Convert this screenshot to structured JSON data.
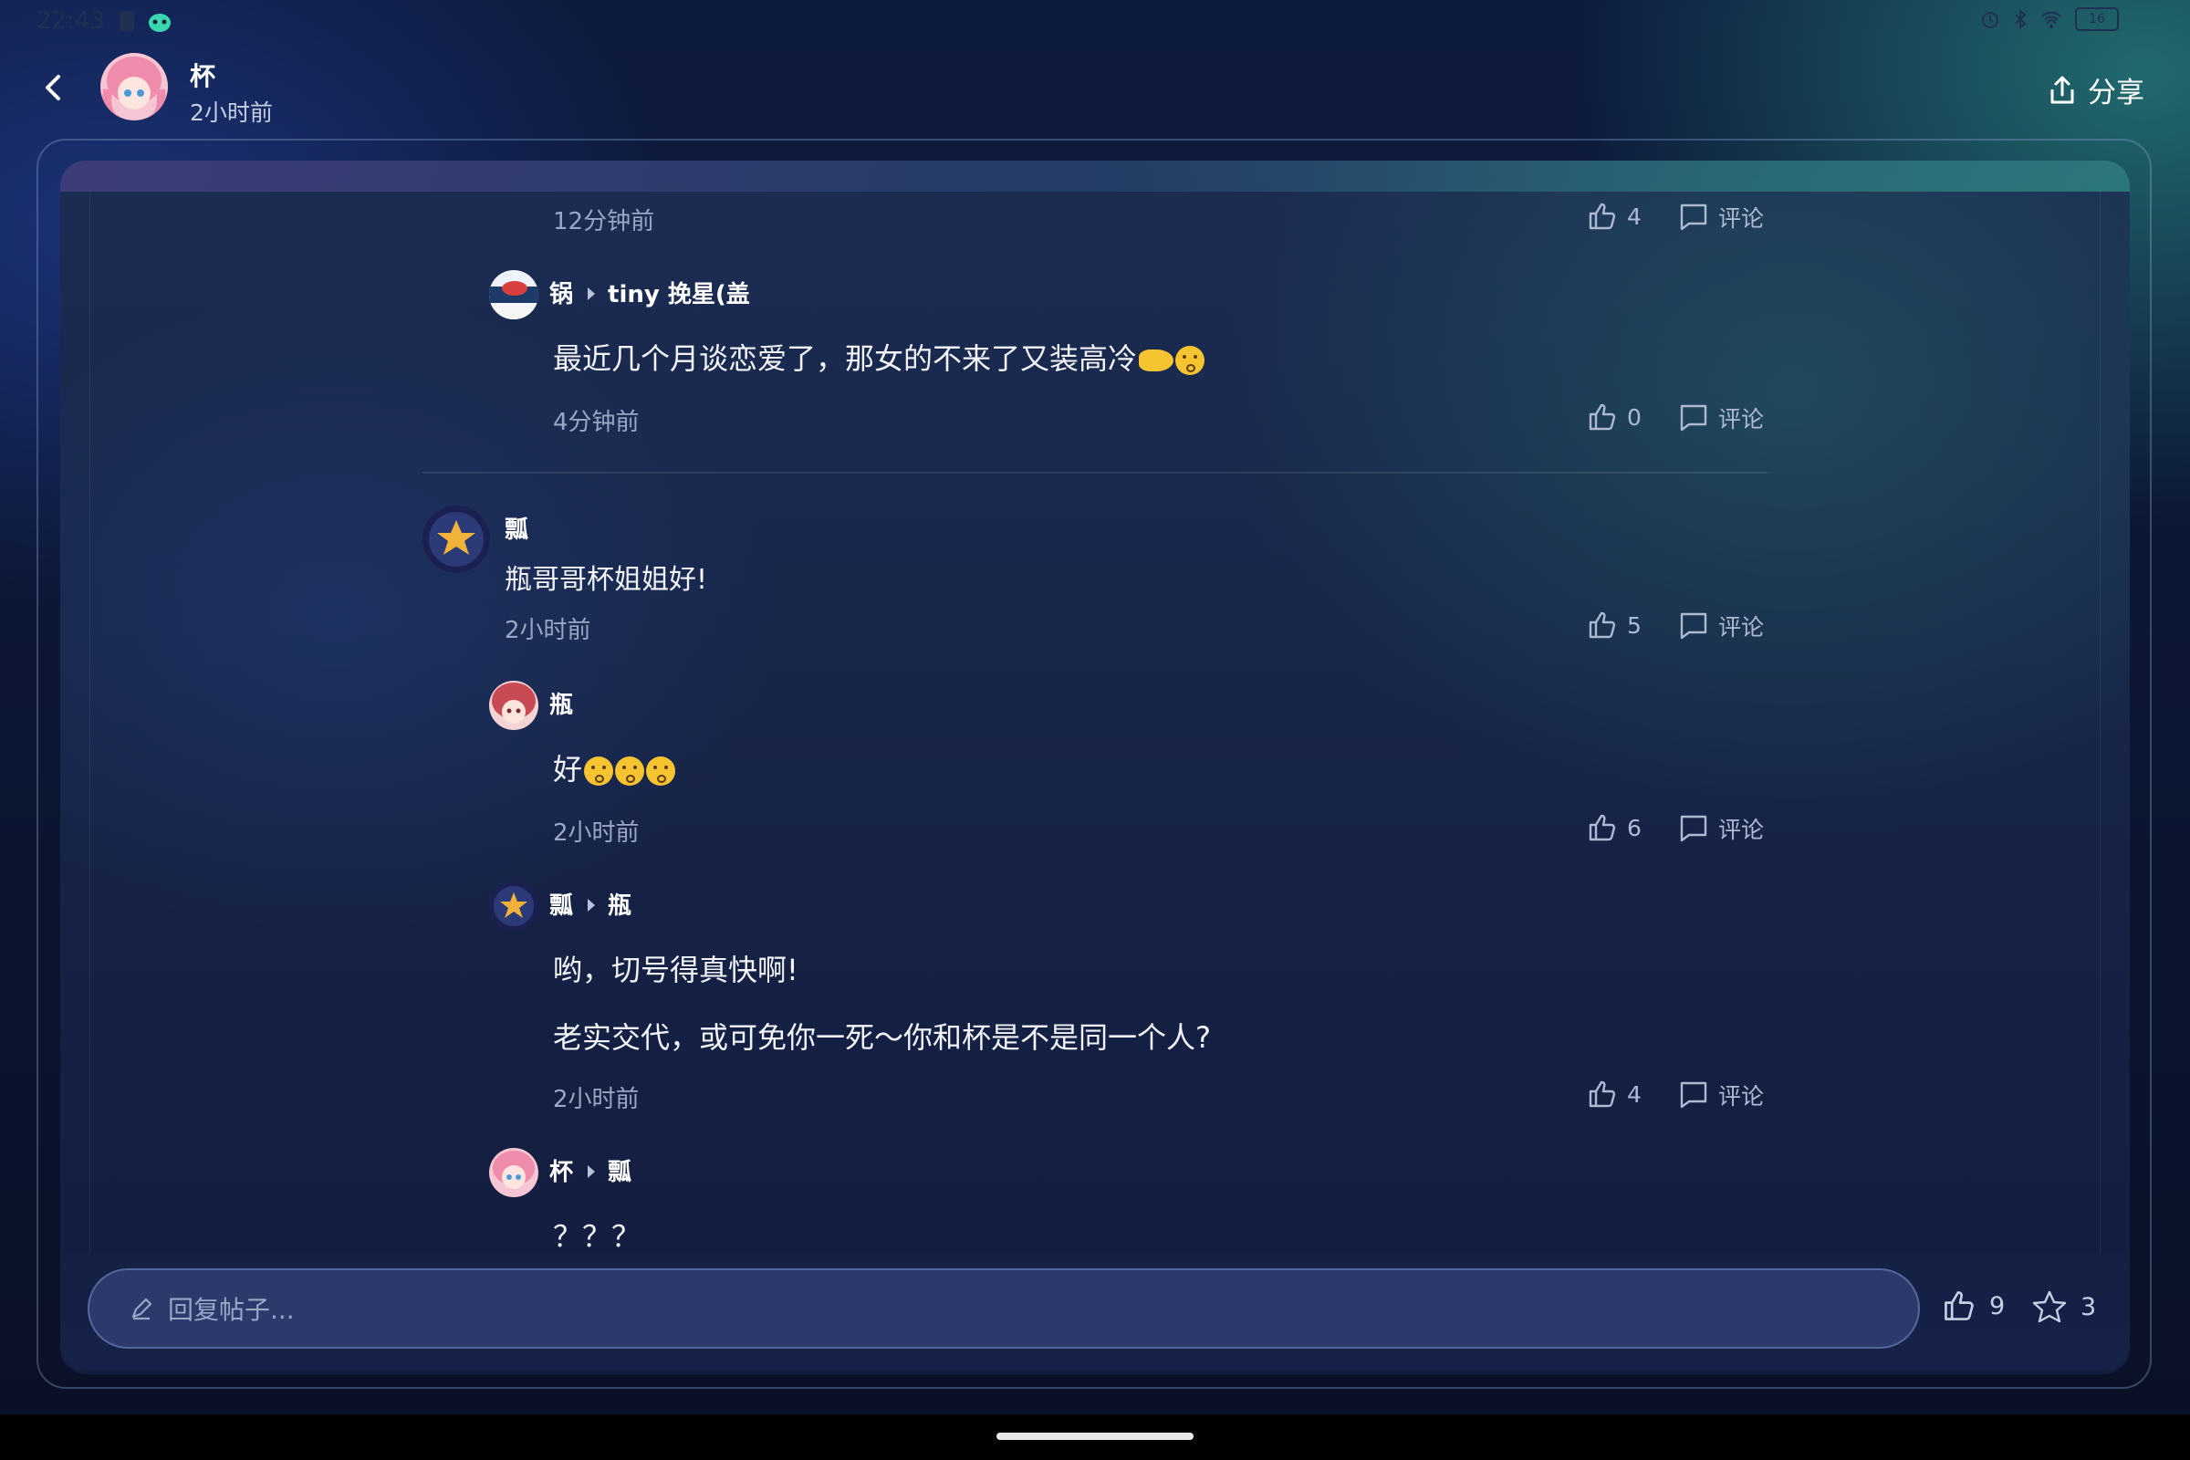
{
  "status_bar": {
    "time": "22:43",
    "battery": "16"
  },
  "header": {
    "author": "杯",
    "time": "2小时前",
    "share_label": "分享"
  },
  "comments": [
    {
      "time": "12分钟前",
      "likes": "4",
      "comment_label": "评论"
    },
    {
      "author": "锅",
      "reply_to": "tiny 挽星(盖",
      "text": "最近几个月谈恋爱了，那女的不来了又装高冷",
      "time": "4分钟前",
      "likes": "0",
      "comment_label": "评论"
    },
    {
      "author": "瓢",
      "text": "瓶哥哥杯姐姐好!",
      "time": "2小时前",
      "likes": "5",
      "comment_label": "评论"
    },
    {
      "author": "瓶",
      "text": "好",
      "time": "2小时前",
      "likes": "6",
      "comment_label": "评论"
    },
    {
      "author": "瓢",
      "reply_to": "瓶",
      "text_line1": "哟，切号得真快啊!",
      "text_line2": "老实交代，或可免你一死～你和杯是不是同一个人?",
      "time": "2小时前",
      "likes": "4",
      "comment_label": "评论"
    },
    {
      "author": "杯",
      "reply_to": "瓢",
      "text": "？？？"
    }
  ],
  "reply_bar": {
    "placeholder": "回复帖子...",
    "likes": "9",
    "favorites": "3"
  },
  "icons": [
    "back-icon",
    "share-icon",
    "thumb-up-icon",
    "comment-icon",
    "pencil-icon",
    "star-icon",
    "alarm-icon",
    "bluetooth-icon",
    "wifi-icon",
    "battery-icon"
  ]
}
